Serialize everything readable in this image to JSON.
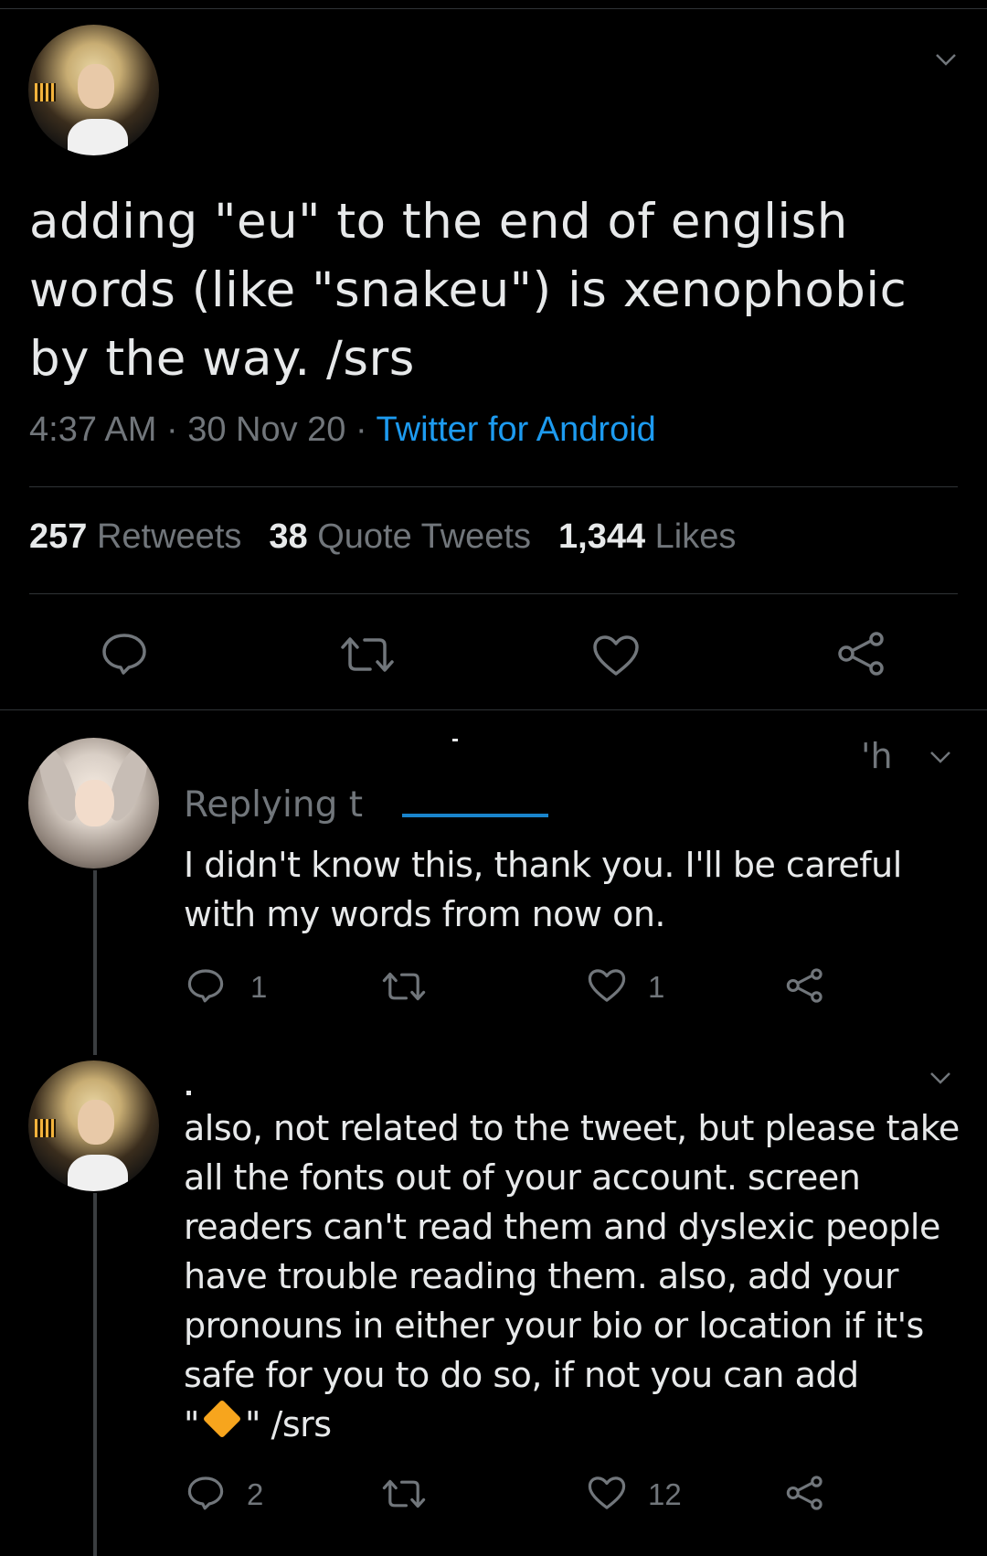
{
  "tweet": {
    "text": "adding \"eu\" to the end of english\nwords (like \"snakeu\") is xenophobic\nby the way. /srs",
    "time": "4:37 AM",
    "date": "30 Nov 20",
    "source": "Twitter for Android",
    "separator": " · ",
    "stats": {
      "retweets_count": "257",
      "retweets_label": "Retweets",
      "quotes_count": "38",
      "quotes_label": "Quote Tweets",
      "likes_count": "1,344",
      "likes_label": "Likes"
    },
    "actions": [
      "reply-icon",
      "retweet-icon",
      "like-icon",
      "share-icon"
    ]
  },
  "replies": [
    {
      "time": "'h",
      "replying_to": "Replying t",
      "text": "I didn't know this, thank you. I'll be careful\nwith my words from now on.",
      "reply_count": "1",
      "retweet_count": "",
      "like_count": "1"
    },
    {
      "text_before_emoji": "also, not related to the tweet, but please take\nall the fonts out of your account. screen\nreaders can't read them and dyslexic people\nhave trouble reading them. also, add your\npronouns in either your bio or location if it's\nsafe for you to do so, if not you can add\n\"",
      "text_after_emoji": "\" /srs",
      "emoji": "orange-diamond-icon",
      "reply_count": "2",
      "retweet_count": "",
      "like_count": "12"
    }
  ],
  "colors": {
    "background": "#000000",
    "text": "#e7e9ea",
    "secondary": "#71767b",
    "link": "#1d9bf0",
    "divider": "#2f3336",
    "emoji_diamond": "#f7a51d"
  }
}
